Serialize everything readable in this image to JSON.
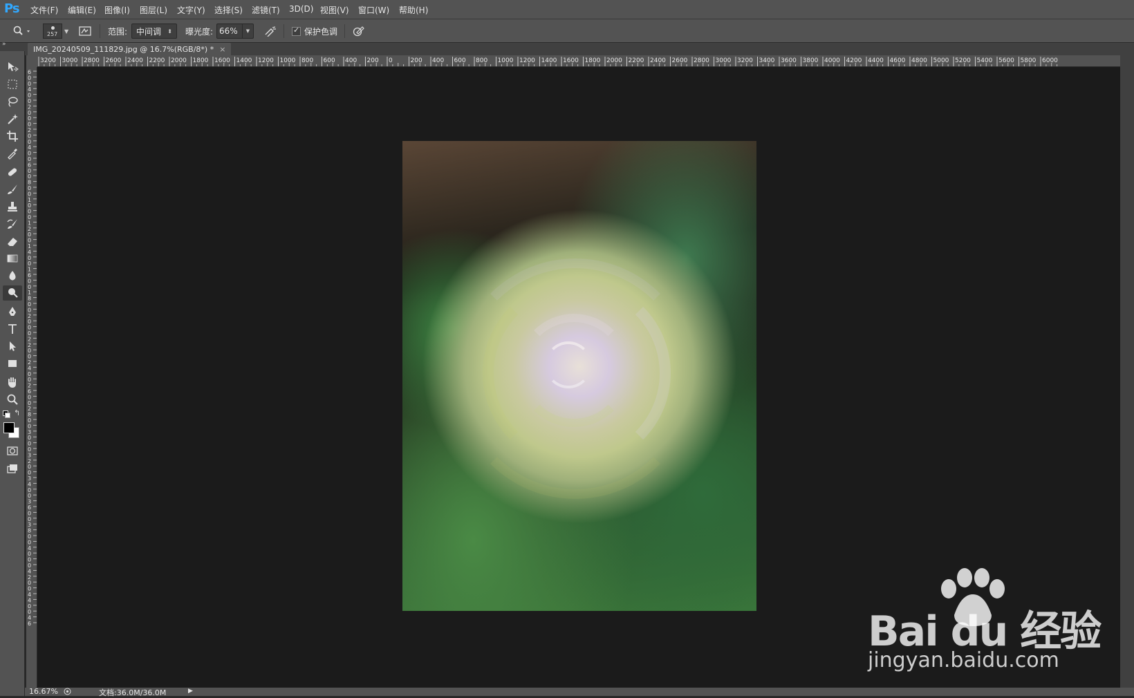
{
  "app": {
    "logo": "Ps"
  },
  "menubar": {
    "items": [
      "文件(F)",
      "编辑(E)",
      "图像(I)",
      "图层(L)",
      "文字(Y)",
      "选择(S)",
      "滤镜(T)",
      "3D(D)",
      "视图(V)",
      "窗口(W)",
      "帮助(H)"
    ]
  },
  "options": {
    "brush_size": "257",
    "range_label": "范围:",
    "range_value": "中间调",
    "exposure_label": "曝光度:",
    "exposure_value": "66%",
    "protect_tones_label": "保护色调",
    "protect_tones_checked": true
  },
  "document": {
    "tab_title": "IMG_20240509_111829.jpg @ 16.7%(RGB/8*) *",
    "close_glyph": "×"
  },
  "ruler_h": {
    "labels": [
      "3200",
      "3000",
      "2800",
      "2600",
      "2400",
      "2200",
      "2000",
      "1800",
      "1600",
      "1400",
      "1200",
      "1000",
      "800",
      "600",
      "400",
      "200",
      "0",
      "200",
      "400",
      "600",
      "800",
      "1000",
      "1200",
      "1400",
      "1600",
      "1800",
      "2000",
      "2200",
      "2400",
      "2600",
      "2800",
      "3000",
      "3200",
      "3400",
      "3600",
      "3800",
      "4000",
      "4200",
      "4400",
      "4600",
      "4800",
      "5000",
      "5200",
      "5400",
      "5600",
      "5800",
      "6000"
    ]
  },
  "ruler_v": {
    "labels": [
      "6",
      "0",
      "0",
      "4",
      "0",
      "0",
      "2",
      "0",
      "0",
      "0",
      "2",
      "0",
      "0",
      "4",
      "0",
      "0",
      "6",
      "0",
      "0",
      "8",
      "0",
      "0",
      "1",
      "0",
      "0",
      "0",
      "1",
      "2",
      "0",
      "0",
      "1",
      "4",
      "0",
      "0",
      "1",
      "6",
      "0",
      "0",
      "1",
      "8",
      "0",
      "0",
      "2",
      "0",
      "0",
      "0",
      "2",
      "2",
      "0",
      "0",
      "2",
      "4",
      "0",
      "0",
      "2",
      "6",
      "0",
      "0",
      "2",
      "8",
      "0",
      "0",
      "3",
      "0",
      "0",
      "0",
      "3",
      "2",
      "0",
      "0",
      "3",
      "4",
      "0",
      "0",
      "3",
      "6",
      "0",
      "0",
      "3",
      "8",
      "0",
      "0",
      "4",
      "0",
      "0",
      "0",
      "4",
      "2",
      "0",
      "0",
      "4",
      "4",
      "0",
      "0",
      "4",
      "6"
    ]
  },
  "toolbar": {
    "tools": [
      "move-tool",
      "marquee-tool",
      "lasso-tool",
      "magic-wand-tool",
      "crop-tool",
      "eyedropper-tool",
      "healing-brush-tool",
      "brush-tool",
      "clone-stamp-tool",
      "history-brush-tool",
      "eraser-tool",
      "gradient-tool",
      "blur-tool",
      "burn-tool",
      "pen-tool",
      "type-tool",
      "path-selection-tool",
      "rectangle-tool",
      "hand-tool",
      "zoom-tool"
    ],
    "active_tool": "burn-tool",
    "foreground_color": "#000000",
    "background_color": "#ffffff"
  },
  "statusbar": {
    "zoom": "16.67%",
    "doc_info": "文档:36.0M/36.0M"
  },
  "watermark": {
    "brand": "Bai du 经验",
    "url": "jingyan.baidu.com"
  }
}
